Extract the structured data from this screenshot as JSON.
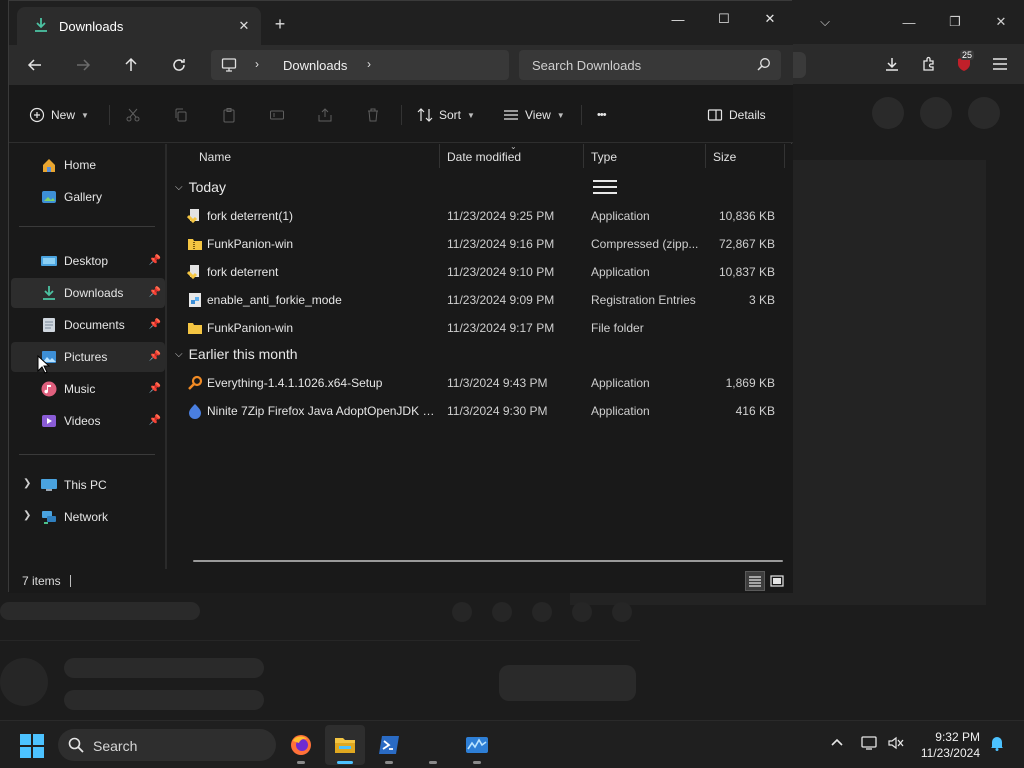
{
  "window": {
    "tab_title": "Downloads",
    "controls": {
      "minimize": "—",
      "maximize": "☐",
      "close": "✕"
    }
  },
  "navigation": {
    "breadcrumb": "Downloads",
    "search_placeholder": "Search Downloads"
  },
  "commandbar": {
    "new_label": "New",
    "sort_label": "Sort",
    "view_label": "View",
    "more_label": "•••",
    "details_label": "Details"
  },
  "sidebar": {
    "quick": [
      {
        "label": "Home",
        "icon": "home-icon"
      },
      {
        "label": "Gallery",
        "icon": "gallery-icon"
      }
    ],
    "pinned": [
      {
        "label": "Desktop",
        "icon": "desktop-icon"
      },
      {
        "label": "Downloads",
        "icon": "downloads-icon",
        "selected": true
      },
      {
        "label": "Documents",
        "icon": "documents-icon"
      },
      {
        "label": "Pictures",
        "icon": "pictures-icon",
        "hover": true
      },
      {
        "label": "Music",
        "icon": "music-icon"
      },
      {
        "label": "Videos",
        "icon": "videos-icon"
      }
    ],
    "locations": [
      {
        "label": "This PC",
        "icon": "this-pc-icon"
      },
      {
        "label": "Network",
        "icon": "network-icon"
      }
    ]
  },
  "columns": {
    "name": "Name",
    "date": "Date modified",
    "type": "Type",
    "size": "Size"
  },
  "groups": [
    {
      "label": "Today",
      "files": [
        {
          "name": "fork deterrent(1)",
          "date": "11/23/2024 9:25 PM",
          "type": "Application",
          "size": "10,836 KB",
          "icon": "application-icon"
        },
        {
          "name": "FunkPanion-win",
          "date": "11/23/2024 9:16 PM",
          "type": "Compressed (zipp...",
          "size": "72,867 KB",
          "icon": "zip-folder-icon"
        },
        {
          "name": "fork deterrent",
          "date": "11/23/2024 9:10 PM",
          "type": "Application",
          "size": "10,837 KB",
          "icon": "application-icon"
        },
        {
          "name": "enable_anti_forkie_mode",
          "date": "11/23/2024 9:09 PM",
          "type": "Registration Entries",
          "size": "3 KB",
          "icon": "registry-file-icon"
        },
        {
          "name": "FunkPanion-win",
          "date": "11/23/2024 9:17 PM",
          "type": "File folder",
          "size": "",
          "icon": "folder-icon"
        }
      ]
    },
    {
      "label": "Earlier this month",
      "files": [
        {
          "name": "Everything-1.4.1.1026.x64-Setup",
          "date": "11/3/2024 9:43 PM",
          "type": "Application",
          "size": "1,869 KB",
          "icon": "everything-app-icon"
        },
        {
          "name": "Ninite 7Zip Firefox Java AdoptOpenJDK x...",
          "date": "11/3/2024 9:30 PM",
          "type": "Application",
          "size": "416 KB",
          "icon": "ninite-app-icon"
        }
      ]
    }
  ],
  "status": {
    "item_count": "7 items"
  },
  "taskbar": {
    "search_label": "Search",
    "time": "9:32 PM",
    "date": "11/23/2024"
  },
  "browser": {
    "badge": "25"
  },
  "colors": {
    "accent": "#4cc2ff",
    "download_green": "#4cc2a2",
    "folder_yellow": "#f4c542"
  }
}
